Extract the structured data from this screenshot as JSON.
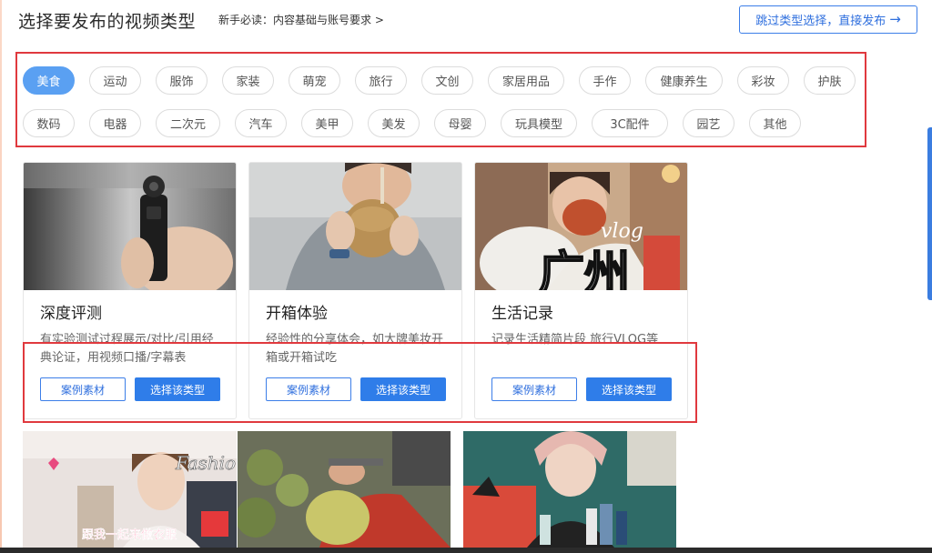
{
  "header": {
    "title": "选择要发布的视频类型",
    "guide_link": "新手必读：内容基础与账号要求 >",
    "skip_button": "跳过类型选择，直接发布",
    "skip_icon": "arrow-right-icon"
  },
  "categories": {
    "row1": [
      "美食",
      "运动",
      "服饰",
      "家装",
      "萌宠",
      "旅行",
      "文创",
      "家居用品",
      "手作",
      "健康养生",
      "彩妆",
      "护肤"
    ],
    "row2": [
      "数码",
      "电器",
      "二次元",
      "汽车",
      "美甲",
      "美发",
      "母婴",
      "玩具模型",
      "3C配件",
      "园艺",
      "其他"
    ],
    "selected": "美食"
  },
  "cards": [
    {
      "title": "深度评测",
      "description": "有实验测试过程展示/对比/引用经典论证，用视频口播/字幕表",
      "case_button": "案例素材",
      "select_button": "选择该类型"
    },
    {
      "title": "开箱体验",
      "description": "经验性的分享体会，如大牌美妆开箱或开箱试吃",
      "case_button": "案例素材",
      "select_button": "选择该类型"
    },
    {
      "title": "生活记录",
      "description": "记录生活精简片段 旅行VLOG等",
      "case_button": "案例素材",
      "select_button": "选择该类型"
    }
  ],
  "thumb_text": {
    "vlog": "vlog",
    "city": "广州",
    "fashion": "Fashion",
    "caption": "跟我一起来做衣服"
  },
  "colors": {
    "accent": "#2f7de9",
    "active_pill": "#5aa0f2",
    "highlight_box": "#e0393e"
  }
}
